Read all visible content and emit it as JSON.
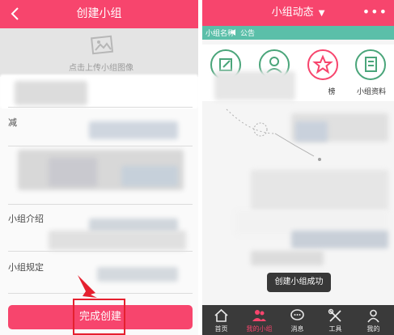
{
  "left_screen": {
    "header": {
      "back_icon": "chevron-left-icon",
      "title": "创建小组"
    },
    "cover": {
      "upload_icon": "photo-icon",
      "upload_hint": "点击上传小组图像"
    },
    "fields": [
      {
        "label": "减"
      },
      {
        "label": "小组介绍"
      },
      {
        "label": "小组规定"
      }
    ],
    "finish_button": {
      "label": "完成创建",
      "color": "#f7456d"
    },
    "highlight_color": "#e5202f"
  },
  "right_screen": {
    "header": {
      "title": "小组动态",
      "dropdown_icon": "chevron-down-icon",
      "more_icon": "more-dots-icon"
    },
    "notice": {
      "group_name": "小组名称",
      "icon": "speaker-icon",
      "label": "公告",
      "color": "#5bbfa9"
    },
    "quick_actions": [
      {
        "icon": "edit-icon",
        "label": "",
        "color": "#4aa57a"
      },
      {
        "icon": "person-icon",
        "label": "",
        "color": "#4aa57a"
      },
      {
        "icon": "star-icon",
        "label": "榜",
        "color": "#f7456d"
      },
      {
        "icon": "document-icon",
        "label": "小组资料",
        "color": "#4aa57a"
      }
    ],
    "toast": "创建小组成功",
    "tabbar": [
      {
        "icon": "home-icon",
        "label": "首页",
        "active": false
      },
      {
        "icon": "group-icon",
        "label": "我的小组",
        "active": true
      },
      {
        "icon": "chat-icon",
        "label": "消息",
        "active": false
      },
      {
        "icon": "tools-icon",
        "label": "工具",
        "active": false
      },
      {
        "icon": "user-icon",
        "label": "我的",
        "active": false
      }
    ]
  },
  "accent_color": "#f7456d"
}
